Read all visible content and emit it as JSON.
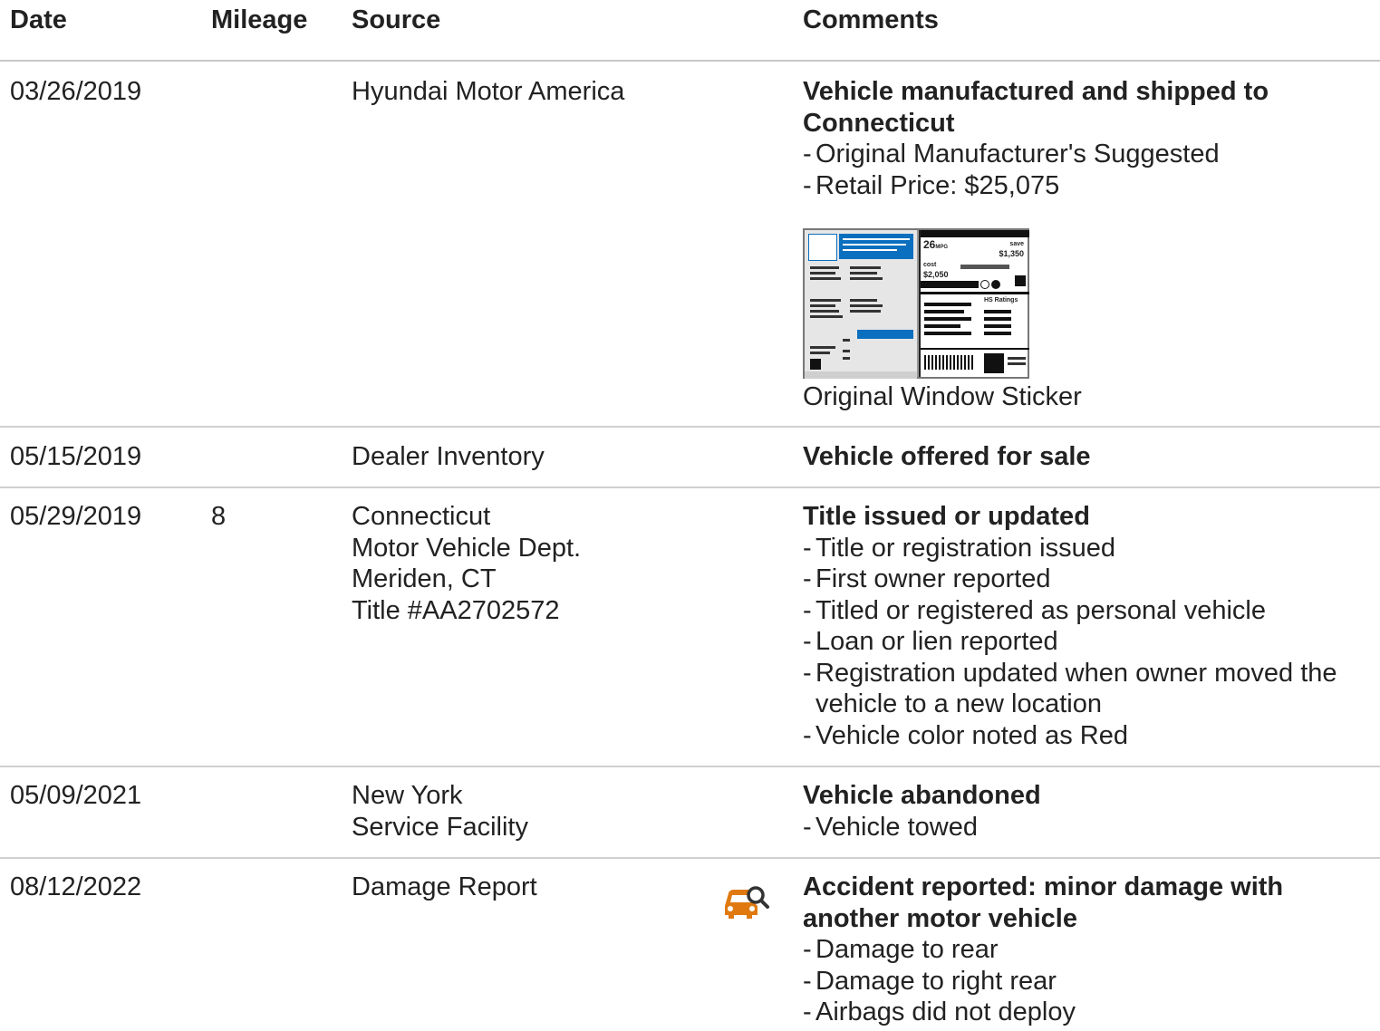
{
  "headers": {
    "date": "Date",
    "mileage": "Mileage",
    "source": "Source",
    "comments": "Comments"
  },
  "rows": [
    {
      "date": "03/26/2019",
      "mileage": "",
      "source": [
        "Hyundai Motor America"
      ],
      "title": "Vehicle manufactured and shipped to Connecticut",
      "details": [
        "Original Manufacturer's Suggested",
        "Retail Price: $25,075"
      ],
      "sticker": {
        "caption": "Original Window Sticker",
        "mpg": "26",
        "mpg_unit": "MPG",
        "save_label": "save",
        "save_value": "$1,350",
        "cost_label": "cost",
        "cost_value": "$2,050",
        "ratings_label": "HS Ratings"
      }
    },
    {
      "date": "05/15/2019",
      "mileage": "",
      "source": [
        "Dealer Inventory"
      ],
      "title": "Vehicle offered for sale",
      "details": []
    },
    {
      "date": "05/29/2019",
      "mileage": "8",
      "source": [
        "Connecticut",
        "Motor Vehicle Dept.",
        "Meriden, CT",
        "Title #AA2702572"
      ],
      "title": "Title issued or updated",
      "details": [
        "Title or registration issued",
        "First owner reported",
        "Titled or registered as personal vehicle",
        "Loan or lien reported",
        "Registration updated when owner moved the vehicle to a new location",
        "Vehicle color noted as Red"
      ]
    },
    {
      "date": "05/09/2021",
      "mileage": "",
      "source": [
        "New York",
        "Service Facility"
      ],
      "title": "Vehicle abandoned",
      "details": [
        "Vehicle towed"
      ]
    },
    {
      "date": "08/12/2022",
      "mileage": "",
      "source": [
        "Damage Report"
      ],
      "icon": "car-damage-search-icon",
      "icon_color": "#e07a10",
      "title": "Accident reported: minor damage with another motor vehicle",
      "details": [
        "Damage to rear",
        "Damage to right rear",
        "Airbags did not deploy"
      ]
    }
  ]
}
